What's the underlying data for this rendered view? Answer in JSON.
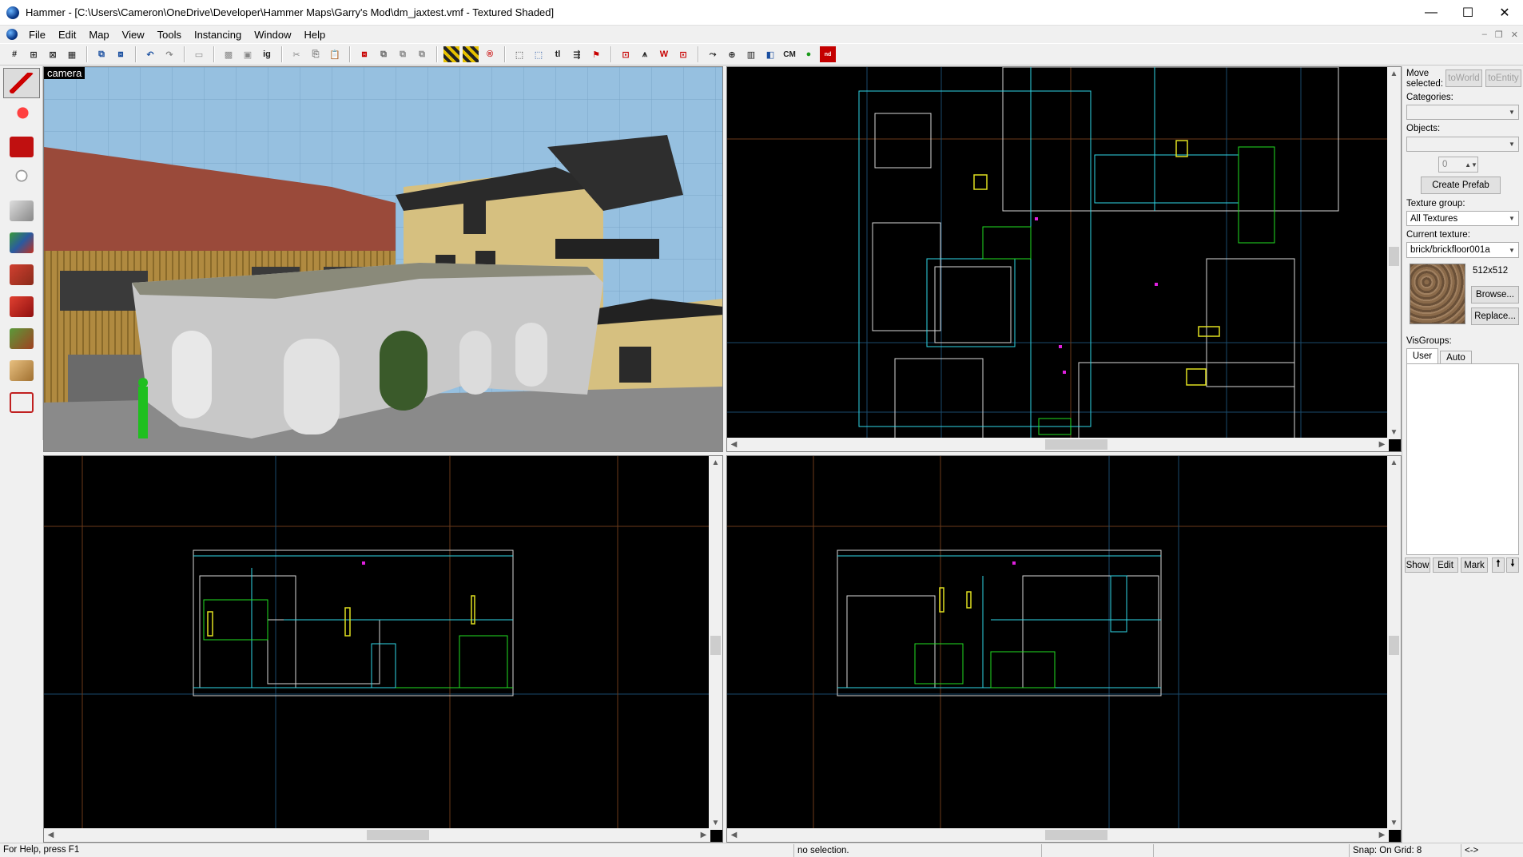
{
  "window": {
    "title": "Hammer - [C:\\Users\\Cameron\\OneDrive\\Developer\\Hammer Maps\\Garry's Mod\\dm_jaxtest.vmf - Textured Shaded]",
    "minimize": "—",
    "maximize": "☐",
    "close": "✕"
  },
  "menu": {
    "items": [
      "File",
      "Edit",
      "Map",
      "View",
      "Tools",
      "Instancing",
      "Window",
      "Help"
    ],
    "mdi_minimize": "–",
    "mdi_restore": "❐",
    "mdi_close": "✕"
  },
  "toolbar": {
    "cm_label": "CM"
  },
  "viewports": {
    "camera_label": "camera"
  },
  "right_panel": {
    "move_selected_label": "Move selected:",
    "to_world": "toWorld",
    "to_entity": "toEntity",
    "categories_label": "Categories:",
    "categories_value": "",
    "objects_label": "Objects:",
    "objects_value": "",
    "count_value": "0",
    "create_prefab": "Create Prefab",
    "texture_group_label": "Texture group:",
    "texture_group_value": "All Textures",
    "current_texture_label": "Current texture:",
    "current_texture_value": "brick/brickfloor001a",
    "texture_size": "512x512",
    "browse": "Browse...",
    "replace": "Replace...",
    "visgroups_label": "VisGroups:",
    "tab_user": "User",
    "tab_auto": "Auto",
    "show": "Show",
    "edit": "Edit",
    "mark": "Mark",
    "up": "🠕",
    "down": "🠗"
  },
  "status": {
    "help": "For Help, press F1",
    "selection": "no selection.",
    "snap": "Snap: On Grid: 8",
    "extra": "<->"
  }
}
